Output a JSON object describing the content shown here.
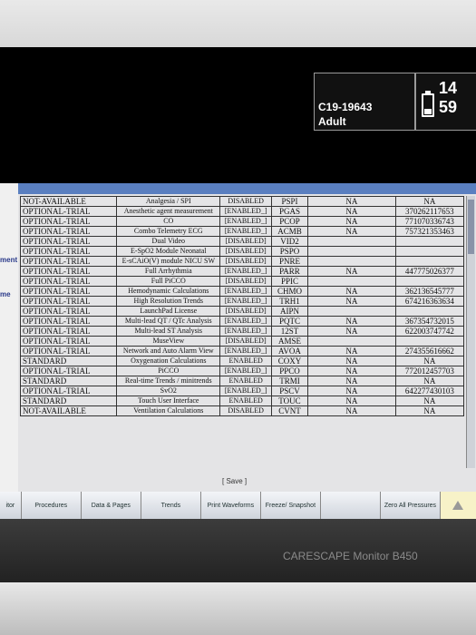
{
  "header": {
    "patient_id": "C19-19643",
    "patient_category": "Adult",
    "clock": "14 59"
  },
  "sidebar": {
    "labels": [
      "ment",
      "me"
    ]
  },
  "table": {
    "rows": [
      [
        "NOT-AVAILABLE",
        "Analgesia / SPI",
        "DISABLED",
        "PSPI",
        "NA",
        "NA"
      ],
      [
        "OPTIONAL-TRIAL",
        "Anesthetic agent measurement",
        "[ENABLED_]",
        "PGAS",
        "NA",
        "370262117653"
      ],
      [
        "OPTIONAL-TRIAL",
        "CO",
        "[ENABLED_]",
        "PCOP",
        "NA",
        "771070336743"
      ],
      [
        "OPTIONAL-TRIAL",
        "Combo Telemetry ECG",
        "[ENABLED_]",
        "ACMB",
        "NA",
        "757321353463"
      ],
      [
        "OPTIONAL-TRIAL",
        "Dual Video",
        "[DISABLED]",
        "VID2",
        "",
        ""
      ],
      [
        "OPTIONAL-TRIAL",
        "E-SpO2 Module Neonatal",
        "[DISABLED]",
        "PSPO",
        "",
        ""
      ],
      [
        "OPTIONAL-TRIAL",
        "E-sCAiO(V) module NICU SW",
        "[DISABLED]",
        "PNRE",
        "",
        ""
      ],
      [
        "OPTIONAL-TRIAL",
        "Full Arrhythmia",
        "[ENABLED_]",
        "PARR",
        "NA",
        "447775026377"
      ],
      [
        "OPTIONAL-TRIAL",
        "Full PiCCO",
        "[DISABLED]",
        "PPIC",
        "",
        ""
      ],
      [
        "OPTIONAL-TRIAL",
        "Hemodynamic Calculations",
        "[ENABLED_]",
        "CHMO",
        "NA",
        "362136545777"
      ],
      [
        "OPTIONAL-TRIAL",
        "High Resolution Trends",
        "[ENABLED_]",
        "TRH1",
        "NA",
        "674216363634"
      ],
      [
        "OPTIONAL-TRIAL",
        "LaunchPad License",
        "[DISABLED]",
        "AIPN",
        "",
        ""
      ],
      [
        "OPTIONAL-TRIAL",
        "Multi-lead QT / QTc Analysis",
        "[ENABLED_]",
        "PQTC",
        "NA",
        "367354732015"
      ],
      [
        "OPTIONAL-TRIAL",
        "Multi-lead ST Analysis",
        "[ENABLED_]",
        "12ST",
        "NA",
        "622003747742"
      ],
      [
        "OPTIONAL-TRIAL",
        "MuseView",
        "[DISABLED]",
        "AMSE",
        "",
        ""
      ],
      [
        "OPTIONAL-TRIAL",
        "Network and Auto Alarm View",
        "[ENABLED_]",
        "AVOA",
        "NA",
        "274355616662"
      ],
      [
        "STANDARD",
        "Oxygenation Calculations",
        "ENABLED",
        "COXY",
        "NA",
        "NA"
      ],
      [
        "OPTIONAL-TRIAL",
        "PiCCO",
        "[ENABLED_]",
        "PPCO",
        "NA",
        "772012457703"
      ],
      [
        "STANDARD",
        "Real-time Trends / minitrends",
        "ENABLED",
        "TRMI",
        "NA",
        "NA"
      ],
      [
        "OPTIONAL-TRIAL",
        "SvO2",
        "[ENABLED_]",
        "PSCV",
        "NA",
        "642277430103"
      ],
      [
        "STANDARD",
        "Touch User Interface",
        "ENABLED",
        "TOUC",
        "NA",
        "NA"
      ],
      [
        "NOT-AVAILABLE",
        "Ventilation Calculations",
        "DISABLED",
        "CVNT",
        "NA",
        "NA"
      ]
    ],
    "save_label": "[ Save ]"
  },
  "toolbar": {
    "items": [
      "itor",
      "Procedures",
      "Data & Pages",
      "Trends",
      "Print Waveforms",
      "Freeze/ Snapshot",
      "",
      "Zero All Pressures"
    ]
  },
  "brand": "CARESCAPE Monitor B450"
}
